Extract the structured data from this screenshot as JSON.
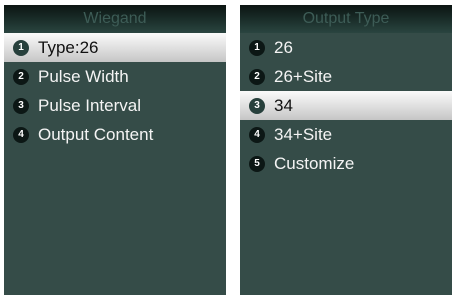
{
  "left_panel": {
    "title": "Wiegand",
    "items": [
      {
        "number": "1",
        "label": "Type:26",
        "selected": true
      },
      {
        "number": "2",
        "label": "Pulse Width",
        "selected": false
      },
      {
        "number": "3",
        "label": "Pulse Interval",
        "selected": false
      },
      {
        "number": "4",
        "label": "Output Content",
        "selected": false
      }
    ]
  },
  "right_panel": {
    "title": "Output Type",
    "items": [
      {
        "number": "1",
        "label": "26",
        "selected": false
      },
      {
        "number": "2",
        "label": "26+Site",
        "selected": false
      },
      {
        "number": "3",
        "label": "34",
        "selected": true
      },
      {
        "number": "4",
        "label": "34+Site",
        "selected": false
      },
      {
        "number": "5",
        "label": "Customize",
        "selected": false
      }
    ]
  },
  "colors": {
    "panel_background": "#354c48",
    "header_text": "#3d5c56",
    "selected_bar": "#e2e2e2",
    "badge": "#0c1715"
  }
}
